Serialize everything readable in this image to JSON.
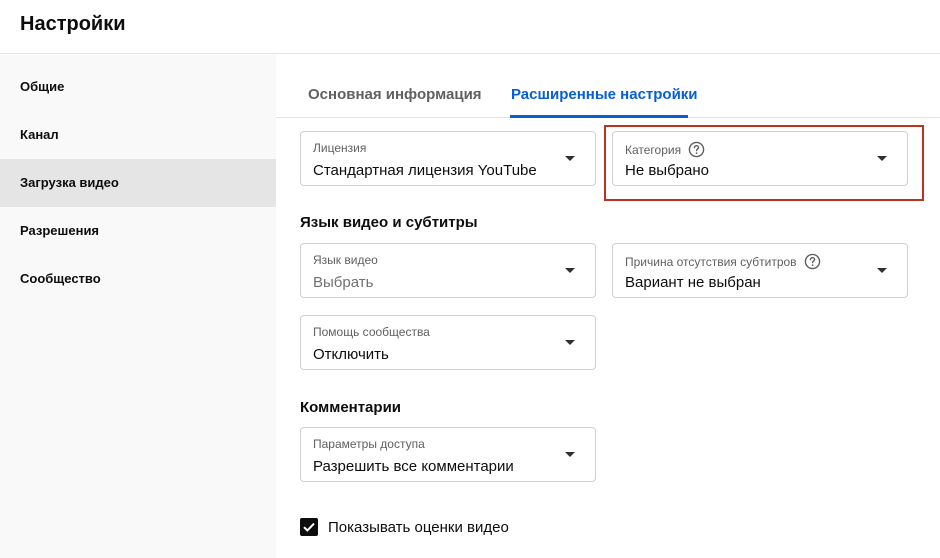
{
  "header": {
    "title": "Настройки"
  },
  "sidebar": {
    "items": [
      {
        "label": "Общие"
      },
      {
        "label": "Канал"
      },
      {
        "label": "Загрузка видео",
        "active": true
      },
      {
        "label": "Разрешения"
      },
      {
        "label": "Сообщество"
      }
    ]
  },
  "tabs": [
    {
      "label": "Основная информация"
    },
    {
      "label": "Расширенные настройки",
      "active": true
    }
  ],
  "fields": {
    "license": {
      "label": "Лицензия",
      "value": "Стандартная лицензия YouTube"
    },
    "category": {
      "label": "Категория",
      "value": "Не выбрано",
      "icon": "help-icon"
    },
    "video_language": {
      "label": "Язык видео",
      "value": "Выбрать"
    },
    "no_captions_reason": {
      "label": "Причина отсутствия субтитров",
      "value": "Вариант не выбран",
      "icon": "help-icon"
    },
    "community_help": {
      "label": "Помощь сообщества",
      "value": "Отключить"
    },
    "comment_access": {
      "label": "Параметры доступа",
      "value": "Разрешить все комментарии"
    }
  },
  "sections": {
    "language_captions": "Язык видео и субтитры",
    "comments": "Комментарии"
  },
  "checkbox": {
    "label": "Показывать оценки видео",
    "checked": true
  },
  "colors": {
    "accent": "#065fd4",
    "highlight": "#c0311f",
    "sidebar_active": "#e5e5e5"
  }
}
